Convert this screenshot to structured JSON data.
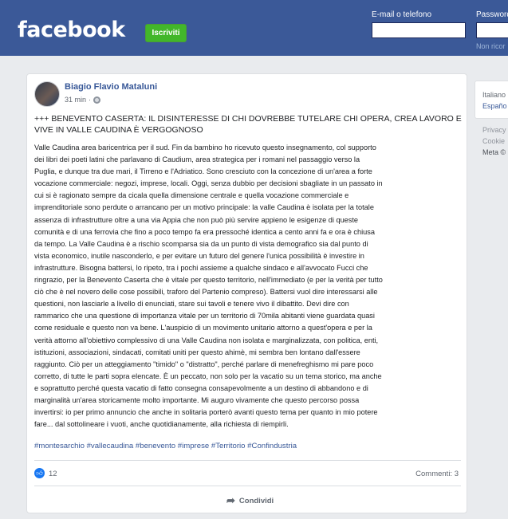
{
  "header": {
    "logo": "facebook",
    "signup_label": "Iscriviti",
    "email_label": "E-mail o telefono",
    "password_label": "Password",
    "forgot_text": "Non ricor"
  },
  "post": {
    "author": "Biagio Flavio Mataluni",
    "time": "31 min",
    "separator": "·",
    "headline": "+++ BENEVENTO CASERTA: IL DISINTERESSE DI CHI DOVREBBE TUTELARE CHI OPERA, CREA LAVORO E VIVE IN VALLE CAUDINA È VERGOGNOSO",
    "body": "Valle Caudina area baricentrica per il sud. Fin da bambino ho ricevuto questo insegnamento, col supporto\ndei libri dei poeti latini che parlavano di Caudium, area strategica per i romani nel passaggio verso la\nPuglia, e dunque tra due mari, il Tirreno e l'Adriatico. Sono cresciuto con la concezione di un'area a forte\nvocazione commerciale: negozi, imprese, locali. Oggi, senza dubbio per decisioni sbagliate in un passato in\ncui si è ragionato sempre da cicala quella dimensione centrale e quella vocazione commerciale e\nimprenditoriale sono perdute o arrancano per un motivo principale: la valle Caudina è isolata per la totale\nassenza di infrastrutture oltre a una via Appia che non può più servire appieno le esigenze di queste\ncomunità e di una ferrovia che fino a poco tempo fa era pressoché identica a cento anni fa e ora è chiusa\nda tempo. La Valle Caudina è a rischio scomparsa sia da un punto di vista demografico sia dal punto di\nvista economico, inutile nasconderlo, e per evitare un futuro del genere l'unica possibilità è investire in\ninfrastrutture. Bisogna battersi, lo ripeto, tra i pochi assieme a qualche sindaco e all'avvocato Fucci che\nringrazio, per la Benevento Caserta che è vitale per questo territorio, nell'immediato (e per la verità per tutto\nciò che è nel novero delle cose possibili, traforo del Partenio compreso). Battersi vuol dire interessarsi alle\nquestioni, non lasciarle a livello di enunciati, stare sui tavoli e tenere vivo il dibattito. Devi dire con\nrammarico che una questione di importanza vitale per un territorio di 70mila abitanti viene guardata quasi\ncome residuale e questo non va bene. L'auspicio di un movimento unitario attorno a quest'opera e per la\nverità attorno all'obiettivo complessivo di una Valle Caudina non isolata e marginalizzata, con politica, enti,\nistituzioni, associazioni, sindacati, comitati uniti per questo ahimè, mi sembra ben lontano dall'essere\nraggiunto. Ciò per un atteggiamento \"timido\" o \"distratto\", perché parlare di menefreghismo mi pare poco\ncorretto, di tutte le parti sopra elencate. È un peccato, non solo per la vacatio su un tema storico, ma anche\ne soprattutto perché questa vacatio di fatto consegna consapevolmente a un destino di abbandono e di\nmarginalità un'area storicamente molto importante. Mi auguro vivamente che questo percorso possa\ninvertirsi: io per primo annuncio che anche in solitaria porterò avanti questo tema per quanto in mio potere\nfare... dal sottolineare i vuoti, anche quotidianamente, alla richiesta di riempirli.",
    "hashtags": "#montesarchio #vallecaudina #benevento #imprese #Territorio #Confindustria",
    "likes": "12",
    "comments": "Commenti: 3",
    "share_label": "Condividi",
    "like_icon": "thumbs-up-icon",
    "share_icon": "share-arrow-icon"
  },
  "sidebar": {
    "languages": [
      "Italiano",
      "Españo"
    ],
    "footer": [
      "Privacy",
      "Cookie",
      "Meta ©"
    ]
  },
  "colors": {
    "brand": "#3b5998",
    "signup": "#42b72a",
    "link": "#385898",
    "like": "#1877f2",
    "background": "#e9ebee"
  }
}
